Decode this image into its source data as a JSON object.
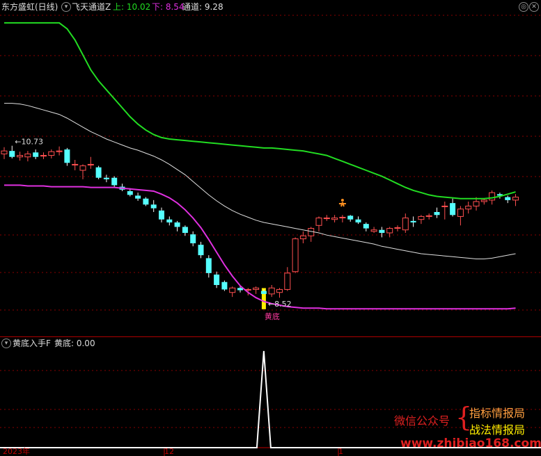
{
  "header": {
    "stock": "东方盛虹(日线)",
    "indicator": "飞天通道Z",
    "up_label": "上: 10.02",
    "down_label": "下: 8.54",
    "mid_label": "通道: 9.28"
  },
  "sub_header": {
    "indicator": "黄底入手F",
    "value_label": "黄底: 0.00"
  },
  "annotations": {
    "high_label": "10.73",
    "low_label": "8.52",
    "signal_label": "黄底"
  },
  "watermark": {
    "wechat": "微信公众号",
    "brace": "{",
    "line1": "指标情报局",
    "line2": "战法情报局",
    "url": "www.zhibiao168.com"
  },
  "x_axis": [
    "2023年",
    "12",
    "1"
  ],
  "colors": {
    "upper_line": "#22dd22",
    "lower_line": "#e030e0",
    "mid_line": "#e0e0e0",
    "up_candle": "#ff5050",
    "down_candle": "#55ffff",
    "signal_bar": "#ffee00",
    "grid": "#8b0000"
  },
  "chart_data": {
    "type": "candlestick",
    "candles": [
      [
        10.62,
        10.71,
        10.55,
        10.66
      ],
      [
        10.66,
        10.73,
        10.56,
        10.58
      ],
      [
        10.58,
        10.65,
        10.53,
        10.6
      ],
      [
        10.58,
        10.66,
        10.52,
        10.62
      ],
      [
        10.64,
        10.68,
        10.55,
        10.58
      ],
      [
        10.6,
        10.64,
        10.55,
        10.6
      ],
      [
        10.6,
        10.68,
        10.56,
        10.65
      ],
      [
        10.65,
        10.72,
        10.6,
        10.66
      ],
      [
        10.68,
        10.7,
        10.46,
        10.5
      ],
      [
        10.48,
        10.54,
        10.4,
        10.48
      ],
      [
        10.4,
        10.48,
        10.28,
        10.46
      ],
      [
        10.48,
        10.58,
        10.42,
        10.48
      ],
      [
        10.44,
        10.46,
        10.28,
        10.3
      ],
      [
        10.3,
        10.34,
        10.24,
        10.28
      ],
      [
        10.3,
        10.32,
        10.18,
        10.2
      ],
      [
        10.18,
        10.22,
        10.12,
        10.14
      ],
      [
        10.12,
        10.16,
        10.05,
        10.07
      ],
      [
        10.06,
        10.1,
        9.99,
        10.02
      ],
      [
        10.02,
        10.04,
        9.92,
        9.94
      ],
      [
        9.94,
        10.0,
        9.84,
        9.89
      ],
      [
        9.86,
        9.9,
        9.7,
        9.74
      ],
      [
        9.74,
        9.78,
        9.66,
        9.7
      ],
      [
        9.7,
        9.72,
        9.58,
        9.64
      ],
      [
        9.64,
        9.66,
        9.52,
        9.56
      ],
      [
        9.54,
        9.58,
        9.38,
        9.42
      ],
      [
        9.4,
        9.44,
        9.22,
        9.26
      ],
      [
        9.22,
        9.26,
        8.96,
        9.02
      ],
      [
        9.0,
        9.04,
        8.82,
        8.86
      ],
      [
        8.9,
        8.92,
        8.78,
        8.8
      ],
      [
        8.76,
        8.84,
        8.7,
        8.82
      ],
      [
        8.82,
        8.84,
        8.76,
        8.79
      ],
      [
        8.8,
        8.82,
        8.72,
        8.8
      ],
      [
        8.8,
        8.84,
        8.74,
        8.82
      ],
      [
        8.78,
        8.8,
        8.74,
        8.74
      ],
      [
        8.74,
        8.86,
        8.7,
        8.82
      ],
      [
        8.76,
        8.82,
        8.69,
        8.8
      ],
      [
        8.8,
        9.1,
        8.78,
        9.02
      ],
      [
        9.04,
        9.5,
        9.02,
        9.48
      ],
      [
        9.48,
        9.58,
        9.42,
        9.52
      ],
      [
        9.52,
        9.64,
        9.44,
        9.62
      ],
      [
        9.66,
        9.78,
        9.58,
        9.76
      ],
      [
        9.76,
        9.8,
        9.72,
        9.76
      ],
      [
        9.74,
        9.8,
        9.7,
        9.76
      ],
      [
        9.76,
        9.8,
        9.7,
        9.77
      ],
      [
        9.79,
        9.8,
        9.71,
        9.74
      ],
      [
        9.74,
        9.78,
        9.68,
        9.7
      ],
      [
        9.68,
        9.7,
        9.58,
        9.62
      ],
      [
        9.58,
        9.64,
        9.56,
        9.6
      ],
      [
        9.6,
        9.64,
        9.5,
        9.56
      ],
      [
        9.56,
        9.64,
        9.5,
        9.62
      ],
      [
        9.62,
        9.66,
        9.58,
        9.63
      ],
      [
        9.6,
        9.82,
        9.56,
        9.76
      ],
      [
        9.72,
        9.78,
        9.64,
        9.7
      ],
      [
        9.74,
        9.8,
        9.68,
        9.78
      ],
      [
        9.78,
        9.82,
        9.74,
        9.79
      ],
      [
        9.84,
        9.9,
        9.76,
        9.8
      ],
      [
        9.92,
        9.98,
        9.74,
        9.92
      ],
      [
        9.96,
        10.02,
        9.78,
        9.8
      ],
      [
        9.78,
        9.92,
        9.66,
        9.88
      ],
      [
        9.88,
        9.98,
        9.82,
        9.92
      ],
      [
        9.92,
        10.04,
        9.86,
        9.98
      ],
      [
        9.98,
        10.02,
        9.94,
        10.0
      ],
      [
        10.0,
        10.13,
        9.94,
        10.1
      ],
      [
        10.08,
        10.1,
        10.02,
        10.06
      ],
      [
        10.04,
        10.06,
        9.96,
        10.0
      ],
      [
        10.0,
        10.08,
        9.92,
        10.04
      ]
    ],
    "upper_channel": [
      12.38,
      12.38,
      12.38,
      12.38,
      12.38,
      12.38,
      12.38,
      12.38,
      12.3,
      12.15,
      11.95,
      11.75,
      11.6,
      11.48,
      11.36,
      11.24,
      11.12,
      11.02,
      10.94,
      10.88,
      10.84,
      10.82,
      10.81,
      10.8,
      10.79,
      10.78,
      10.77,
      10.76,
      10.75,
      10.74,
      10.73,
      10.72,
      10.71,
      10.7,
      10.7,
      10.69,
      10.68,
      10.67,
      10.66,
      10.64,
      10.62,
      10.6,
      10.56,
      10.52,
      10.48,
      10.44,
      10.4,
      10.36,
      10.32,
      10.27,
      10.22,
      10.17,
      10.13,
      10.1,
      10.07,
      10.05,
      10.04,
      10.03,
      10.02,
      10.02,
      10.02,
      10.02,
      10.03,
      10.05,
      10.08,
      10.11
    ],
    "mid_channel": [
      11.3,
      11.3,
      11.29,
      11.27,
      11.24,
      11.21,
      11.18,
      11.15,
      11.1,
      11.04,
      10.98,
      10.92,
      10.87,
      10.82,
      10.78,
      10.74,
      10.7,
      10.67,
      10.63,
      10.59,
      10.54,
      10.48,
      10.41,
      10.34,
      10.25,
      10.16,
      10.07,
      9.99,
      9.92,
      9.86,
      9.81,
      9.77,
      9.73,
      9.7,
      9.68,
      9.66,
      9.64,
      9.62,
      9.6,
      9.58,
      9.56,
      9.53,
      9.51,
      9.49,
      9.47,
      9.45,
      9.43,
      9.41,
      9.38,
      9.36,
      9.34,
      9.32,
      9.3,
      9.28,
      9.27,
      9.26,
      9.25,
      9.24,
      9.23,
      9.22,
      9.21,
      9.21,
      9.22,
      9.24,
      9.26,
      9.28
    ],
    "lower_channel": [
      10.2,
      10.2,
      10.2,
      10.19,
      10.19,
      10.19,
      10.18,
      10.18,
      10.18,
      10.18,
      10.18,
      10.17,
      10.17,
      10.17,
      10.17,
      10.16,
      10.15,
      10.14,
      10.13,
      10.12,
      10.08,
      10.03,
      9.96,
      9.87,
      9.76,
      9.63,
      9.47,
      9.3,
      9.13,
      8.98,
      8.85,
      8.76,
      8.69,
      8.64,
      8.61,
      8.59,
      8.57,
      8.56,
      8.55,
      8.55,
      8.55,
      8.54,
      8.54,
      8.54,
      8.54,
      8.54,
      8.54,
      8.54,
      8.54,
      8.54,
      8.54,
      8.54,
      8.54,
      8.54,
      8.54,
      8.54,
      8.54,
      8.54,
      8.54,
      8.54,
      8.54,
      8.54,
      8.54,
      8.54,
      8.54,
      8.55
    ],
    "signal_index": 33,
    "signal_value": 1,
    "ylim": [
      8.3,
      12.5
    ],
    "sub_ylim": [
      0,
      1
    ]
  }
}
